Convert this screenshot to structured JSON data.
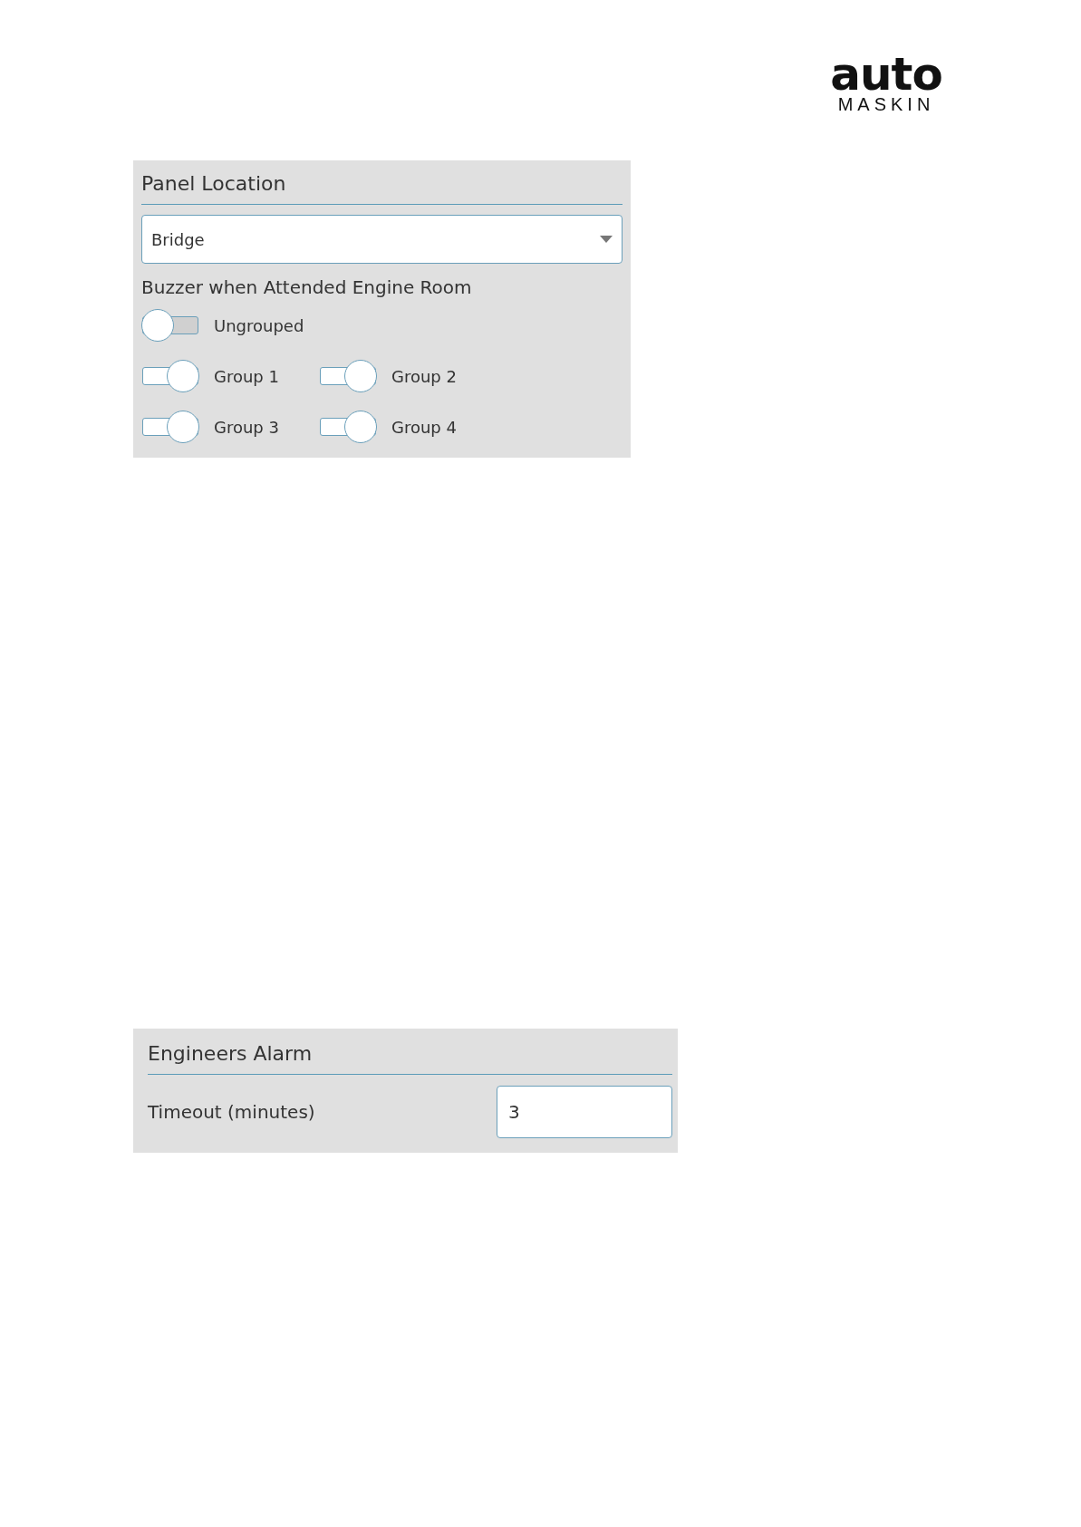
{
  "logo": {
    "wordmark": "auto",
    "subtitle": "MASKIN"
  },
  "panel_location": {
    "title": "Panel Location",
    "select": {
      "value": "Bridge"
    },
    "subheading": "Buzzer when Attended Engine Room",
    "ungrouped": {
      "label": "Ungrouped",
      "on": false
    },
    "groups": [
      {
        "label": "Group 1",
        "on": true
      },
      {
        "label": "Group 2",
        "on": true
      },
      {
        "label": "Group 3",
        "on": true
      },
      {
        "label": "Group 4",
        "on": true
      }
    ]
  },
  "engineers_alarm": {
    "title": "Engineers Alarm",
    "fields": [
      {
        "label": "Timeout (minutes)",
        "value": "3"
      }
    ]
  }
}
